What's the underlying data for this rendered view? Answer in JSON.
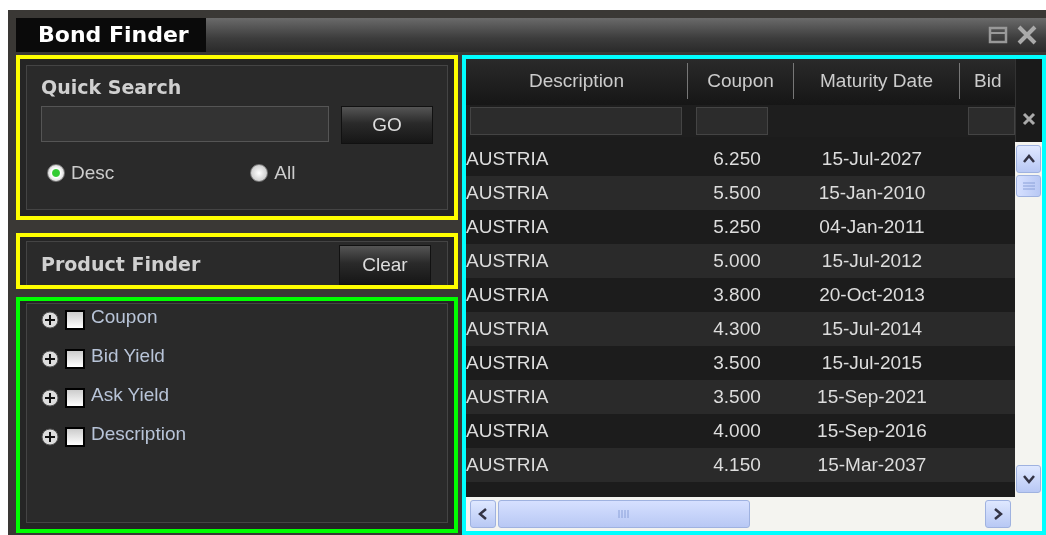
{
  "window": {
    "title": "Bond Finder"
  },
  "quick_search": {
    "title": "Quick Search",
    "go_button": "GO",
    "options": [
      {
        "label": "Desc",
        "selected": true
      },
      {
        "label": "All",
        "selected": false
      }
    ]
  },
  "product_finder": {
    "title": "Product Finder",
    "clear_button": "Clear",
    "tree": [
      {
        "label": "Coupon",
        "expanded": false,
        "checked": false
      },
      {
        "label": "Bid Yield",
        "expanded": false,
        "checked": false
      },
      {
        "label": "Ask Yield",
        "expanded": false,
        "checked": false
      },
      {
        "label": "Description",
        "expanded": false,
        "checked": false
      }
    ]
  },
  "table": {
    "columns": [
      {
        "label": "Description",
        "filter": true
      },
      {
        "label": "Coupon",
        "filter": true
      },
      {
        "label": "Maturity Date",
        "filter": false
      },
      {
        "label": "Bid",
        "filter": true
      }
    ],
    "rows": [
      [
        "AUSTRIA",
        "6.250",
        "15-Jul-2027"
      ],
      [
        "AUSTRIA",
        "5.500",
        "15-Jan-2010"
      ],
      [
        "AUSTRIA",
        "5.250",
        "04-Jan-2011"
      ],
      [
        "AUSTRIA",
        "5.000",
        "15-Jul-2012"
      ],
      [
        "AUSTRIA",
        "3.800",
        "20-Oct-2013"
      ],
      [
        "AUSTRIA",
        "4.300",
        "15-Jul-2014"
      ],
      [
        "AUSTRIA",
        "3.500",
        "15-Jul-2015"
      ],
      [
        "AUSTRIA",
        "3.500",
        "15-Sep-2021"
      ],
      [
        "AUSTRIA",
        "4.000",
        "15-Sep-2016"
      ],
      [
        "AUSTRIA",
        "4.150",
        "15-Mar-2037"
      ]
    ]
  }
}
